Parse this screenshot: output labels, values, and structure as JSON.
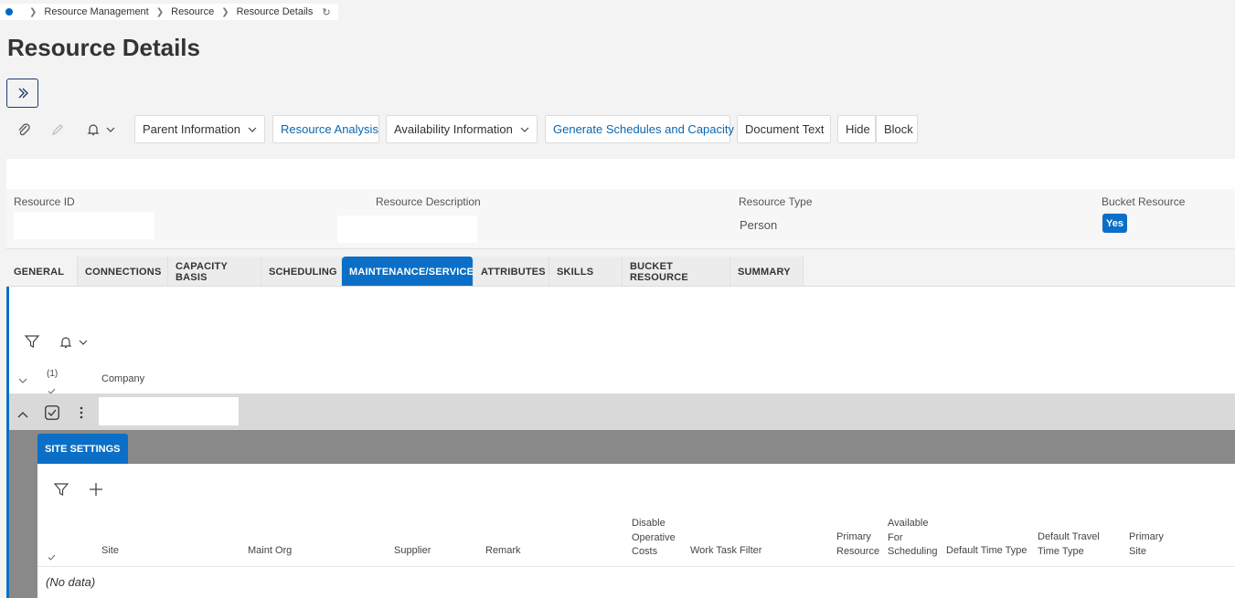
{
  "breadcrumb": {
    "items": [
      "Resource Management",
      "Resource",
      "Resource Details"
    ]
  },
  "page_title": "Resource Details",
  "toolbar": {
    "parent_information": "Parent Information",
    "resource_analysis": "Resource Analysis",
    "availability_information": "Availability Information",
    "generate_schedules": "Generate Schedules and Capacity",
    "document_text": "Document Text",
    "hide": "Hide",
    "block": "Block"
  },
  "header_fields": {
    "resource_id_label": "Resource ID",
    "resource_description_label": "Resource Description",
    "resource_type_label": "Resource Type",
    "resource_type_value": "Person",
    "bucket_resource_label": "Bucket Resource",
    "bucket_resource_value": "Yes"
  },
  "tabs": [
    "GENERAL",
    "CONNECTIONS",
    "CAPACITY BASIS",
    "SCHEDULING",
    "MAINTENANCE/SERVICE",
    "ATTRIBUTES",
    "SKILLS",
    "BUCKET RESOURCE",
    "SUMMARY"
  ],
  "active_tab": "MAINTENANCE/SERVICE",
  "company_list": {
    "selected_count": "(1)",
    "column_company": "Company"
  },
  "site_settings": {
    "tab_label": "SITE SETTINGS",
    "columns": {
      "site": "Site",
      "maint_org": "Maint Org",
      "supplier": "Supplier",
      "remark": "Remark",
      "disable_1": "Disable",
      "disable_2": "Operative",
      "disable_3": "Costs",
      "work_task_filter": "Work Task Filter",
      "primary_resource_1": "Primary",
      "primary_resource_2": "Resource",
      "available_1": "Available",
      "available_2": "For",
      "available_3": "Scheduling",
      "default_time_type": "Default Time Type",
      "default_travel_1": "Default Travel",
      "default_travel_2": "Time Type",
      "primary_site_1": "Primary",
      "primary_site_2": "Site"
    },
    "no_data": "(No data)"
  },
  "colors": {
    "accent": "#0b6fc7",
    "link": "#0b66b0",
    "band": "#898989"
  }
}
